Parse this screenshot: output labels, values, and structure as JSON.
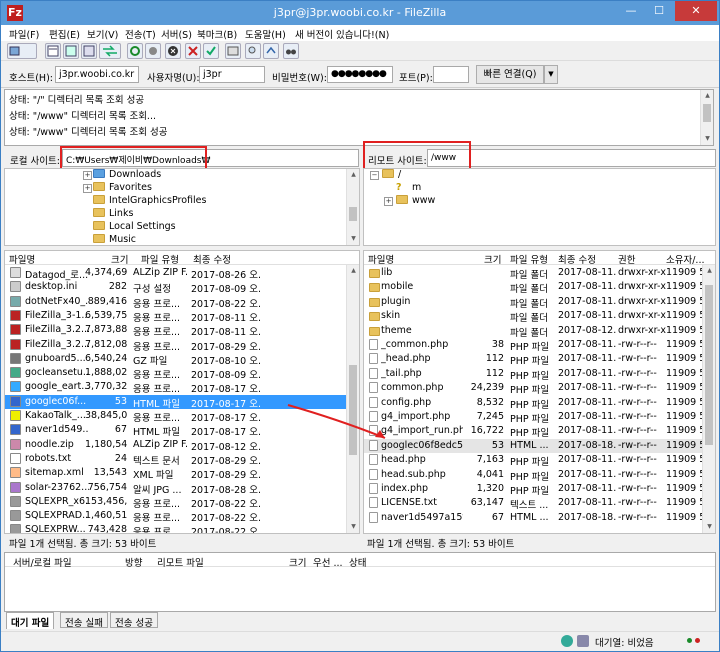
{
  "window": {
    "title": "j3pr@j3pr.woobi.co.kr - FileZilla",
    "min": "—",
    "max": "☐",
    "close": "✕"
  },
  "menu": [
    "파일(F)",
    "편집(E)",
    "보기(V)",
    "전송(T)",
    "서버(S)",
    "북마크(B)",
    "도움말(H)",
    "새 버전이 있습니다!(N)"
  ],
  "quickconnect": {
    "host_label": "호스트(H):",
    "host_value": "j3pr.woobi.co.kr",
    "user_label": "사용자명(U):",
    "user_value": "j3pr",
    "pass_label": "비밀번호(W):",
    "pass_value": "●●●●●●●●",
    "port_label": "포트(P):",
    "port_value": "",
    "connect_label": "빠른 연결(Q)",
    "dropdown": "▼"
  },
  "log": [
    "상태: \"/\" 디렉터리 목록 조회 성공",
    "상태: \"/www\" 디렉터리 목록 조회...",
    "상태: \"/www\" 디렉터리 목록 조회 성공"
  ],
  "local": {
    "site_label": "로컬 사이트:",
    "path": "C:₩Users₩제이비₩Downloads₩",
    "tree": [
      "Downloads",
      "Favorites",
      "IntelGraphicsProfiles",
      "Links",
      "Local Settings",
      "Music"
    ],
    "columns": [
      "파일명",
      "크기",
      "파일 유형",
      "최종 수정"
    ],
    "files": [
      {
        "name": "Datagod_로...",
        "size": "4,374,698",
        "type": "ALZip ZIP F...",
        "date": "2017-08-26 오..."
      },
      {
        "name": "desktop.ini",
        "size": "282",
        "type": "구성 설정",
        "date": "2017-08-09 오..."
      },
      {
        "name": "dotNetFx40_...",
        "size": "889,416",
        "type": "응용 프로...",
        "date": "2017-08-22 오..."
      },
      {
        "name": "FileZilla_3-1...",
        "size": "6,539,752",
        "type": "응용 프로...",
        "date": "2017-08-11 오..."
      },
      {
        "name": "FileZilla_3.2...",
        "size": "7,873,888",
        "type": "응용 프로...",
        "date": "2017-08-11 오..."
      },
      {
        "name": "FileZilla_3.2...",
        "size": "7,812,088",
        "type": "응용 프로...",
        "date": "2017-08-29 오..."
      },
      {
        "name": "gnuboard5...",
        "size": "6,540,246",
        "type": "GZ 파일",
        "date": "2017-08-10 오..."
      },
      {
        "name": "gocleansetu...",
        "size": "1,888,024",
        "type": "응용 프로...",
        "date": "2017-08-09 오..."
      },
      {
        "name": "google_eart...",
        "size": "3,770,324",
        "type": "응용 프로...",
        "date": "2017-08-17 오..."
      },
      {
        "name": "googlec06f...",
        "size": "53",
        "type": "HTML 파일",
        "date": "2017-08-17 오..."
      },
      {
        "name": "KakaoTalk_...",
        "size": "38,845,0...",
        "type": "응용 프로...",
        "date": "2017-08-17 오..."
      },
      {
        "name": "naver1d549...",
        "size": "67",
        "type": "HTML 파일",
        "date": "2017-08-17 오..."
      },
      {
        "name": "noodle.zip",
        "size": "1,180,541",
        "type": "ALZip ZIP F...",
        "date": "2017-08-12 오..."
      },
      {
        "name": "robots.txt",
        "size": "24",
        "type": "텍스트 문서",
        "date": "2017-08-29 오..."
      },
      {
        "name": "sitemap.xml",
        "size": "13,543",
        "type": "XML 파일",
        "date": "2017-08-29 오..."
      },
      {
        "name": "solar-23762...",
        "size": "756,754",
        "type": "알씨 JPG ...",
        "date": "2017-08-28 오..."
      },
      {
        "name": "SQLEXPR_x6...",
        "size": "153,456,...",
        "type": "응용 프로...",
        "date": "2017-08-22 오..."
      },
      {
        "name": "SQLEXPRAD...",
        "size": "1,460,51...",
        "type": "응용 프로...",
        "date": "2017-08-22 오..."
      },
      {
        "name": "SQLEXPRW...",
        "size": "743,428",
        "type": "응용 프로...",
        "date": "2017-08-22 오..."
      }
    ],
    "status": "파일 1개 선택됨. 총 크기: 53 바이트"
  },
  "remote": {
    "site_label": "리모트 사이트:",
    "path": "/www",
    "tree": [
      "/",
      "m",
      "www"
    ],
    "columns": [
      "파일명",
      "크기",
      "파일 유형",
      "최종 수정",
      "권한",
      "소유자/..."
    ],
    "files": [
      {
        "name": "lib",
        "size": "",
        "type": "파일 폴더",
        "date": "2017-08-11...",
        "perm": "drwxr-xr-x",
        "owner": "11909 5..."
      },
      {
        "name": "mobile",
        "size": "",
        "type": "파일 폴더",
        "date": "2017-08-11...",
        "perm": "drwxr-xr-x",
        "owner": "11909 5..."
      },
      {
        "name": "plugin",
        "size": "",
        "type": "파일 폴더",
        "date": "2017-08-11...",
        "perm": "drwxr-xr-x",
        "owner": "11909 5..."
      },
      {
        "name": "skin",
        "size": "",
        "type": "파일 폴더",
        "date": "2017-08-11...",
        "perm": "drwxr-xr-x",
        "owner": "11909 5..."
      },
      {
        "name": "theme",
        "size": "",
        "type": "파일 폴더",
        "date": "2017-08-12...",
        "perm": "drwxr-xr-x",
        "owner": "11909 5..."
      },
      {
        "name": "_common.php",
        "size": "38",
        "type": "PHP 파일",
        "date": "2017-08-11...",
        "perm": "-rw-r--r--",
        "owner": "11909 5..."
      },
      {
        "name": "_head.php",
        "size": "112",
        "type": "PHP 파일",
        "date": "2017-08-11...",
        "perm": "-rw-r--r--",
        "owner": "11909 5..."
      },
      {
        "name": "_tail.php",
        "size": "112",
        "type": "PHP 파일",
        "date": "2017-08-11...",
        "perm": "-rw-r--r--",
        "owner": "11909 5..."
      },
      {
        "name": "common.php",
        "size": "24,239",
        "type": "PHP 파일",
        "date": "2017-08-11...",
        "perm": "-rw-r--r--",
        "owner": "11909 5..."
      },
      {
        "name": "config.php",
        "size": "8,532",
        "type": "PHP 파일",
        "date": "2017-08-11...",
        "perm": "-rw-r--r--",
        "owner": "11909 5..."
      },
      {
        "name": "g4_import.php",
        "size": "7,245",
        "type": "PHP 파일",
        "date": "2017-08-11...",
        "perm": "-rw-r--r--",
        "owner": "11909 5..."
      },
      {
        "name": "g4_import_run.php",
        "size": "16,722",
        "type": "PHP 파일",
        "date": "2017-08-11...",
        "perm": "-rw-r--r--",
        "owner": "11909 5..."
      },
      {
        "name": "googlec06f8edc5c...",
        "size": "53",
        "type": "HTML ...",
        "date": "2017-08-18...",
        "perm": "-rw-r--r--",
        "owner": "11909 5..."
      },
      {
        "name": "head.php",
        "size": "7,163",
        "type": "PHP 파일",
        "date": "2017-08-11...",
        "perm": "-rw-r--r--",
        "owner": "11909 5..."
      },
      {
        "name": "head.sub.php",
        "size": "4,041",
        "type": "PHP 파일",
        "date": "2017-08-11...",
        "perm": "-rw-r--r--",
        "owner": "11909 5..."
      },
      {
        "name": "index.php",
        "size": "1,320",
        "type": "PHP 파일",
        "date": "2017-08-11...",
        "perm": "-rw-r--r--",
        "owner": "11909 5..."
      },
      {
        "name": "LICENSE.txt",
        "size": "63,147",
        "type": "텍스트 ...",
        "date": "2017-08-11...",
        "perm": "-rw-r--r--",
        "owner": "11909 5..."
      },
      {
        "name": "naver1d5497a15f6...",
        "size": "67",
        "type": "HTML ...",
        "date": "2017-08-18...",
        "perm": "-rw-r--r--",
        "owner": "11909 5..."
      }
    ],
    "status": "파일 1개 선택됨. 총 크기: 53 바이트"
  },
  "queue": {
    "columns": [
      "서버/로컬 파일",
      "방향",
      "리모트 파일",
      "크기",
      "우선 ...",
      "상태"
    ]
  },
  "tabs": [
    "대기 파일",
    "전송 실패",
    "전송 성공"
  ],
  "statusbar": {
    "queue_text": "대기열: 비었음"
  },
  "colors": {
    "title_bar": "#5a9bd8",
    "selection": "#3399ff",
    "annotation": "#e02020"
  }
}
